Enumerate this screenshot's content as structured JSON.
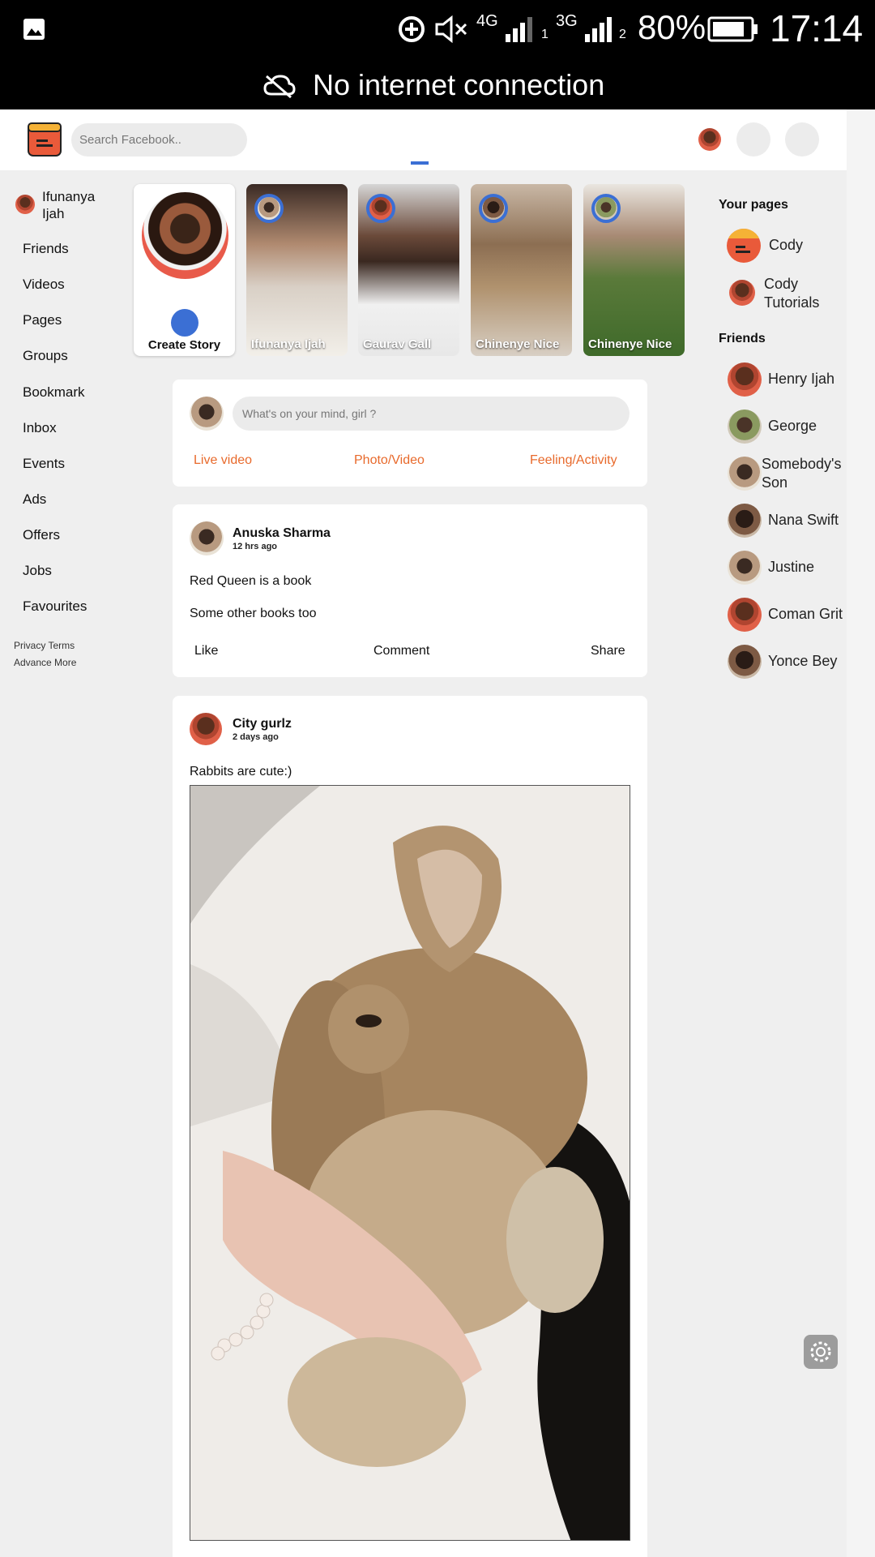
{
  "status_bar": {
    "network_4g": "4G",
    "network_3g": "3G",
    "sim1": "1",
    "sim2": "2",
    "battery": "80%",
    "time": "17:14",
    "notice": "No internet connection"
  },
  "header": {
    "search_placeholder": "Search Facebook.."
  },
  "left_nav": {
    "user_name": "Ifunanya Ijah",
    "items": [
      "Friends",
      "Videos",
      "Pages",
      "Groups",
      "Bookmark",
      "Inbox",
      "Events",
      "Ads",
      "Offers",
      "Jobs",
      "Favourites"
    ],
    "footer_line1": "Privacy Terms",
    "footer_line2": "Advance More"
  },
  "stories": {
    "create_label": "Create Story",
    "items": [
      {
        "name": "Ifunanya Ijah"
      },
      {
        "name": "Gaurav Gall"
      },
      {
        "name": "Chinenye Nice"
      },
      {
        "name": "Chinenye Nice"
      }
    ]
  },
  "composer": {
    "placeholder": "What's on your mind, girl ?",
    "live_video": "Live video",
    "photo_video": "Photo/Video",
    "feeling": "Feeling/Activity",
    "accent_color": "#e86a2c"
  },
  "posts": [
    {
      "author": "Anuska Sharma",
      "time": "12 hrs ago",
      "line1": "Red Queen is a book",
      "line2": "Some other books too",
      "like": "Like",
      "comment": "Comment",
      "share": "Share"
    },
    {
      "author": "City gurlz",
      "time": "2 days ago",
      "text": "Rabbits are cute:)"
    }
  ],
  "right_panel": {
    "pages_title": "Your pages",
    "pages": [
      "Cody",
      "Cody Tutorials"
    ],
    "friends_title": "Friends",
    "friends": [
      "Henry Ijah",
      "George",
      "Somebody's Son",
      "Nana Swift",
      "Justine",
      "Coman Grit",
      "Yonce Bey"
    ]
  },
  "colors": {
    "brand_blue": "#3b6fd4",
    "logo_red": "#e95a3a"
  }
}
